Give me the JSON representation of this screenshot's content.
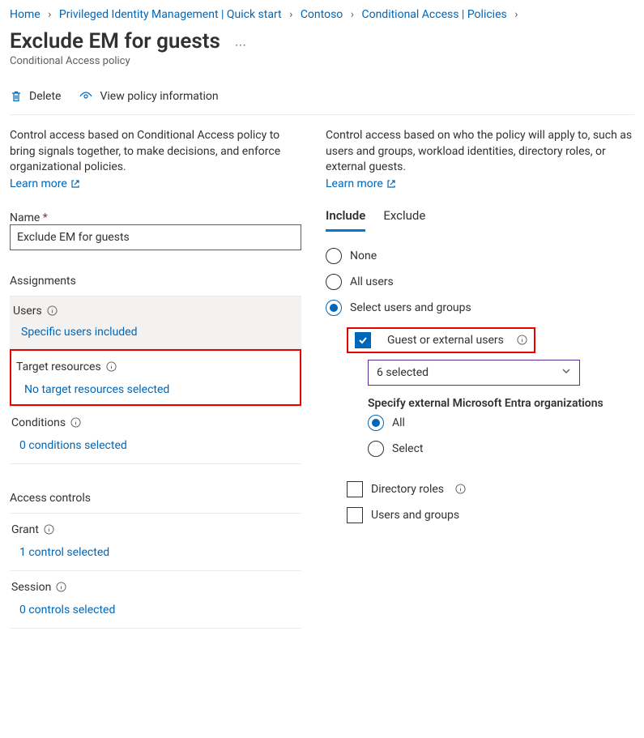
{
  "breadcrumb": {
    "items": [
      {
        "label": "Home"
      },
      {
        "label": "Privileged Identity Management | Quick start"
      },
      {
        "label": "Contoso"
      },
      {
        "label": "Conditional Access | Policies"
      }
    ]
  },
  "header": {
    "title": "Exclude EM for guests",
    "subtitle": "Conditional Access policy"
  },
  "toolbar": {
    "delete_label": "Delete",
    "view_label": "View policy information"
  },
  "left": {
    "description": "Control access based on Conditional Access policy to bring signals together, to make decisions, and enforce organizational policies.",
    "learn": "Learn more",
    "name_label": "Name",
    "name_value": "Exclude EM for guests",
    "assignments_head": "Assignments",
    "users": {
      "title": "Users",
      "status": "Specific users included"
    },
    "target": {
      "title": "Target resources",
      "status": "No target resources selected"
    },
    "conditions": {
      "title": "Conditions",
      "status": "0 conditions selected"
    },
    "access_head": "Access controls",
    "grant": {
      "title": "Grant",
      "status": "1 control selected"
    },
    "session": {
      "title": "Session",
      "status": "0 controls selected"
    }
  },
  "right": {
    "description": "Control access based on who the policy will apply to, such as users and groups, workload identities, directory roles, or external guests.",
    "learn": "Learn more",
    "tabs": {
      "include": "Include",
      "exclude": "Exclude"
    },
    "radios": {
      "none": "None",
      "all": "All users",
      "select": "Select users and groups"
    },
    "guest_label": "Guest or external users",
    "dropdown_value": "6 selected",
    "org_head": "Specify external Microsoft Entra organizations",
    "org_all": "All",
    "org_select": "Select",
    "dir_roles": "Directory roles",
    "users_groups": "Users and groups"
  }
}
